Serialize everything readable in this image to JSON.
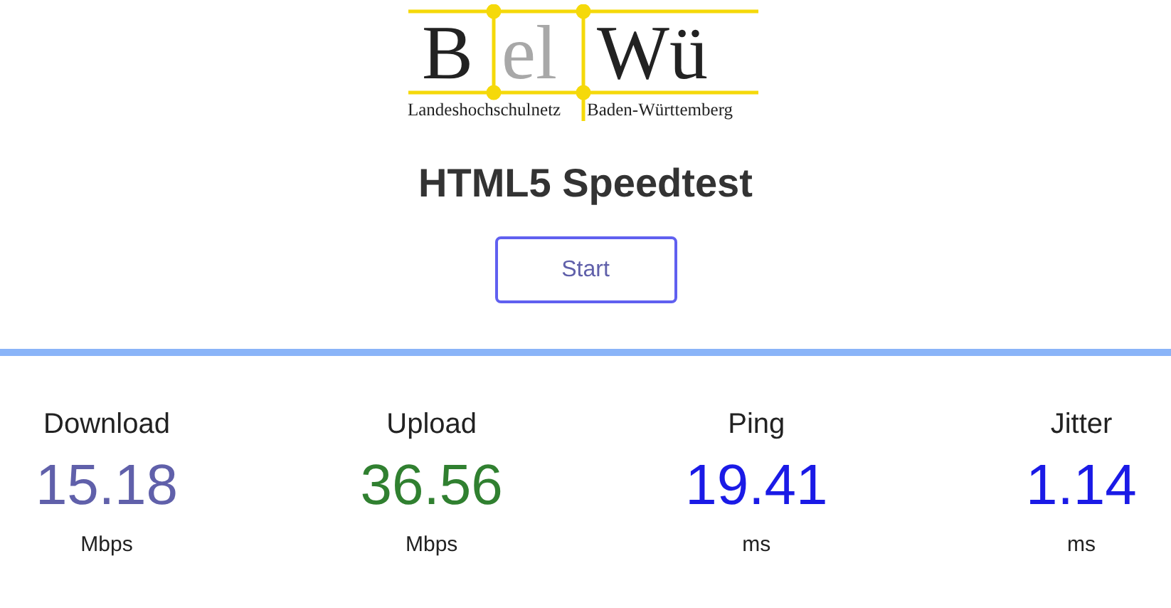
{
  "logo": {
    "letters": [
      "B",
      "el",
      "Wü"
    ],
    "subtitle": [
      "Landeshochschulnetz",
      "Baden-Württemberg"
    ]
  },
  "title": "HTML5 Speedtest",
  "start_button": "Start",
  "meters": [
    {
      "label": "Download",
      "value": "15.18",
      "unit": "Mbps",
      "color": "#6060aa"
    },
    {
      "label": "Upload",
      "value": "36.56",
      "unit": "Mbps",
      "color": "#308030"
    },
    {
      "label": "Ping",
      "value": "19.41",
      "unit": "ms",
      "color": "#1a1ae6"
    },
    {
      "label": "Jitter",
      "value": "1.14",
      "unit": "ms",
      "color": "#1a1ae6"
    }
  ]
}
